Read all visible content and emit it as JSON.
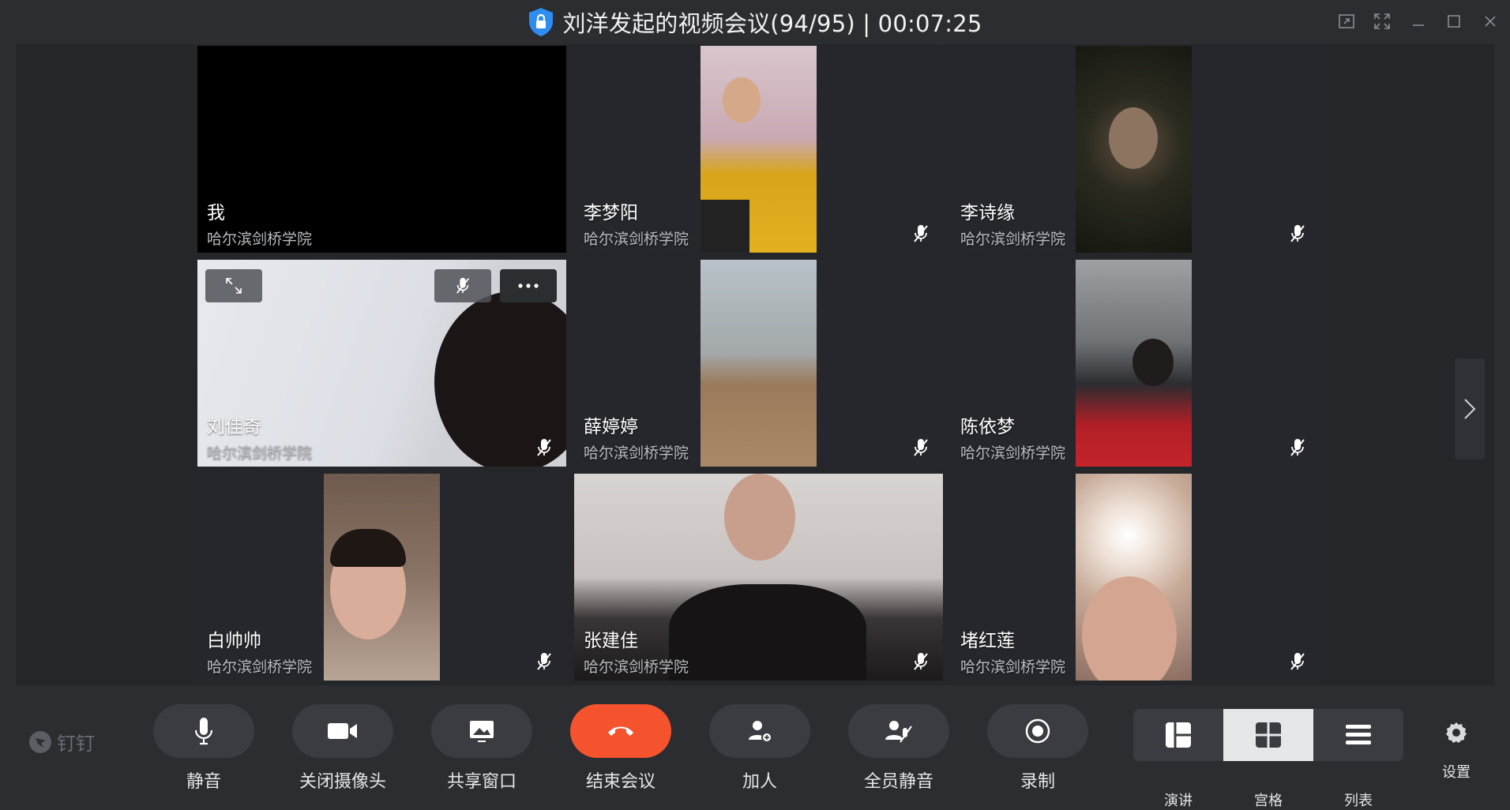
{
  "window": {
    "title": "刘洋发起的视频会议(94/95) | 00:07:25"
  },
  "participants": [
    {
      "name": "我",
      "org": "哈尔滨剑桥学院"
    },
    {
      "name": "李梦阳",
      "org": "哈尔滨剑桥学院"
    },
    {
      "name": "李诗缘",
      "org": "哈尔滨剑桥学院"
    },
    {
      "name": "刘佳奇",
      "org": "哈尔滨剑桥学院"
    },
    {
      "name": "薛婷婷",
      "org": "哈尔滨剑桥学院"
    },
    {
      "name": "陈依梦",
      "org": "哈尔滨剑桥学院"
    },
    {
      "name": "白帅帅",
      "org": "哈尔滨剑桥学院"
    },
    {
      "name": "张建佳",
      "org": "哈尔滨剑桥学院"
    },
    {
      "name": "堵红莲",
      "org": "哈尔滨剑桥学院"
    }
  ],
  "toolbar": {
    "logo": "钉钉",
    "mute": "静音",
    "camera_off": "关闭摄像头",
    "share": "共享窗口",
    "end": "结束会议",
    "add": "加人",
    "mute_all": "全员静音",
    "record": "录制",
    "layout_speaker": "演讲",
    "layout_grid": "宫格",
    "layout_list": "列表",
    "settings": "设置"
  },
  "colors": {
    "end_button": "#f5532e",
    "shield": "#2f8cf0",
    "layout_active": "#e6e7e9"
  }
}
